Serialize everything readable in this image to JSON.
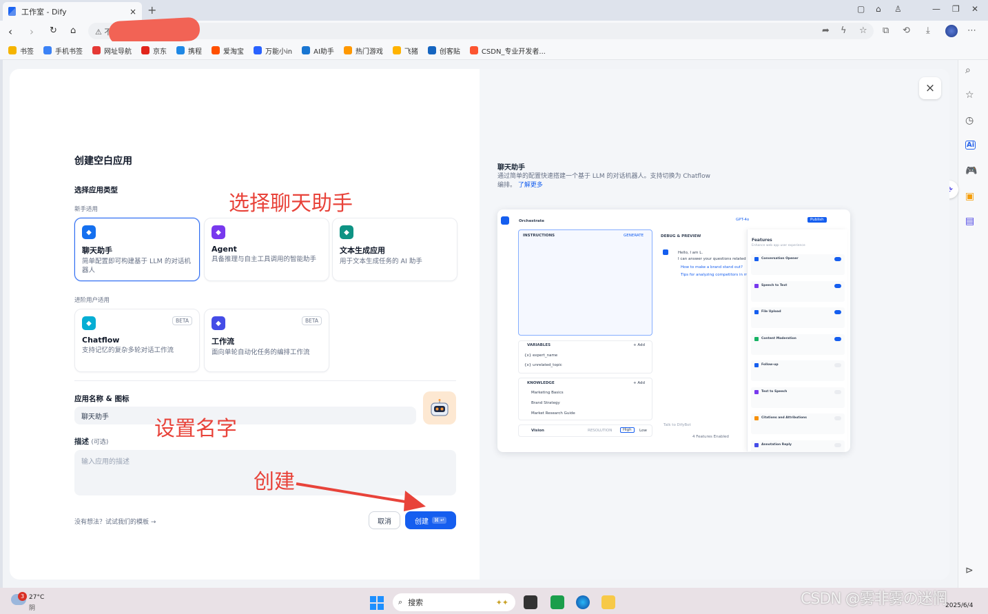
{
  "browser": {
    "tab_title": "工作室 - Dify",
    "tab_close": "×",
    "new_tab": "+",
    "url_prefix": "不安",
    "bookmarks": [
      {
        "label": "书签",
        "color": "#f5b400"
      },
      {
        "label": "手机书签",
        "color": "#3b82f6"
      },
      {
        "label": "网址导航",
        "color": "#e53935"
      },
      {
        "label": "京东",
        "color": "#e1251b"
      },
      {
        "label": "携程",
        "color": "#1e88e5"
      },
      {
        "label": "爱淘宝",
        "color": "#ff5000"
      },
      {
        "label": "万能小in",
        "color": "#2962ff"
      },
      {
        "label": "AI助手",
        "color": "#1976d2"
      },
      {
        "label": "热门游戏",
        "color": "#ff9800"
      },
      {
        "label": "飞猪",
        "color": "#ffb300"
      },
      {
        "label": "创客贴",
        "color": "#1565c0"
      },
      {
        "label": "CSDN_专业开发者...",
        "color": "#fc5531"
      }
    ]
  },
  "dialog": {
    "close": "×",
    "title": "创建空白应用",
    "type_label": "选择应用类型",
    "beginner_label": "新手适用",
    "advanced_label": "进阶用户适用",
    "cards_beginner": [
      {
        "title": "聊天助手",
        "desc": "简单配置即可构建基于 LLM 的对话机器人",
        "color": "#1570ef",
        "selected": true
      },
      {
        "title": "Agent",
        "desc": "具备推理与自主工具调用的智能助手",
        "color": "#7839ee",
        "selected": false
      },
      {
        "title": "文本生成应用",
        "desc": "用于文本生成任务的 AI 助手",
        "color": "#0e9384",
        "selected": false
      }
    ],
    "cards_advanced": [
      {
        "title": "Chatflow",
        "desc": "支持记忆的复杂多轮对话工作流",
        "color": "#06aed4",
        "badge": "BETA"
      },
      {
        "title": "工作流",
        "desc": "面向单轮自动化任务的编排工作流",
        "color": "#444ce7",
        "badge": "BETA"
      }
    ],
    "name_label": "应用名称 & 图标",
    "name_value": "聊天助手",
    "desc_label": "描述",
    "desc_optional": "(可选)",
    "desc_placeholder": "输入应用的描述",
    "template_link": "没有想法？试试我们的模板",
    "cancel_label": "取消",
    "create_label": "创建",
    "create_shortcut": "⌘ ↵"
  },
  "annotations": {
    "select_chat": "选择聊天助手",
    "set_name": "设置名字",
    "create": "创建"
  },
  "preview": {
    "title": "聊天助手",
    "desc": "通过简单的配置快速搭建一个基于 LLM 的对话机器人。支持切换为 Chatflow 编排。",
    "learn_more": "了解更多",
    "orchestrate": "Orchestrate",
    "model": "GPT-4o",
    "publish": "Publish",
    "instructions": "INSTRUCTIONS",
    "generate": "GENERATE",
    "debug": "DEBUG & PREVIEW",
    "hello": "Hello, I am L.",
    "answer": "I can answer your questions related",
    "q1": "How to make a brand stand out?",
    "q2": "Tips for analyzing competitors in market",
    "variables": "VARIABLES",
    "add": "+ Add",
    "var1": "{x} expert_name",
    "var2": "{x} unrelated_topic",
    "knowledge": "KNOWLEDGE",
    "kb1": "Marketing Basics",
    "kb2": "Brand Strategy",
    "kb3": "Market Research Guide",
    "vision": "Vision",
    "resolution": "RESOLUTION",
    "high": "High",
    "low": "Low",
    "talk": "Talk to DifyBot",
    "features_enabled": "4 Features Enabled",
    "features": "Features",
    "features_sub": "Enhance web app user experience",
    "feature_list": [
      "Conversation Opener",
      "Speech to Text",
      "File Upload",
      "Content Moderation",
      "Follow-up",
      "Text to Speech",
      "Citations and Attributions",
      "Annotation Reply"
    ]
  },
  "taskbar": {
    "temp": "27°C",
    "weather": "阴",
    "notif": "3",
    "search": "搜索",
    "date": "2025/6/4",
    "watermark": "CSDN @雾非雾の迷惘"
  }
}
